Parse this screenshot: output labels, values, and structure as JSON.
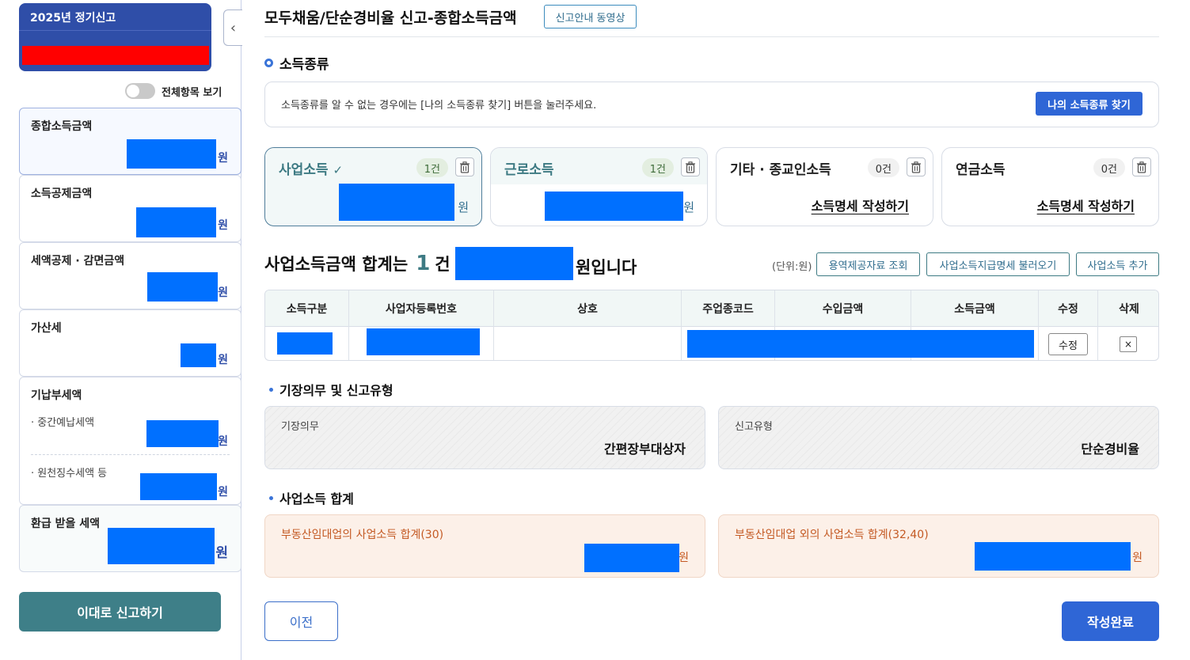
{
  "sidebar": {
    "year_label": "2025년 정기신고",
    "toggle_label": "전체항목 보기",
    "items": [
      {
        "label": "종합소득금액",
        "unit": "원"
      },
      {
        "label": "소득공제금액",
        "unit": "원"
      },
      {
        "label": "세액공제 · 감면금액",
        "unit": "원"
      },
      {
        "label": "가산세",
        "unit": "원"
      },
      {
        "label": "기납부세액",
        "sub": [
          {
            "label": "· 중간예납세액",
            "unit": "원"
          },
          {
            "label": "· 원천징수세액 등",
            "unit": "원"
          }
        ]
      },
      {
        "label": "환급 받을 세액",
        "unit": "원"
      }
    ],
    "report_button": "이대로 신고하기"
  },
  "header": {
    "title": "모두채움/단순경비율 신고-종합소득금액",
    "video_button": "신고안내 동영상"
  },
  "income_type": {
    "section_title": "소득종류",
    "notice": "소득종류를 알 수 없는 경우에는 [나의 소득종류 찾기] 버튼을 눌러주세요.",
    "find_button": "나의 소득종류 찾기",
    "cards": [
      {
        "name": "사업소득",
        "check": "✓",
        "count": "1건",
        "unit": "원",
        "selected": true
      },
      {
        "name": "근로소득",
        "count": "1건",
        "unit": "원"
      },
      {
        "name": "기타 · 종교인소득",
        "count": "0건",
        "link": "소득명세 작성하기"
      },
      {
        "name": "연금소득",
        "count": "0건",
        "link": "소득명세 작성하기"
      }
    ]
  },
  "business_summary": {
    "prefix": "사업소득금액 합계는",
    "count": "1",
    "count_unit": "건",
    "suffix": "원입니다",
    "unit_label": "(단위:원)",
    "buttons": [
      "용역제공자료 조회",
      "사업소득지급명세 불러오기",
      "사업소득 추가"
    ]
  },
  "table": {
    "columns": [
      "소득구분",
      "사업자등록번호",
      "상호",
      "주업종코드",
      "수입금액",
      "소득금액",
      "수정",
      "삭제"
    ],
    "row": {
      "edit": "수정",
      "delete": "×"
    }
  },
  "bookkeeping": {
    "section_title": "기장의무 및 신고유형",
    "duty_label": "기장의무",
    "duty_value": "간편장부대상자",
    "type_label": "신고유형",
    "type_value": "단순경비율"
  },
  "business_total": {
    "section_title": "사업소득 합계",
    "realestate_label": "부동산임대업의 사업소득 합계(30)",
    "other_label": "부동산임대업 외의 사업소득 합계(32,40)",
    "unit": "원"
  },
  "footer": {
    "prev_button": "이전",
    "done_button": "작성완료"
  }
}
